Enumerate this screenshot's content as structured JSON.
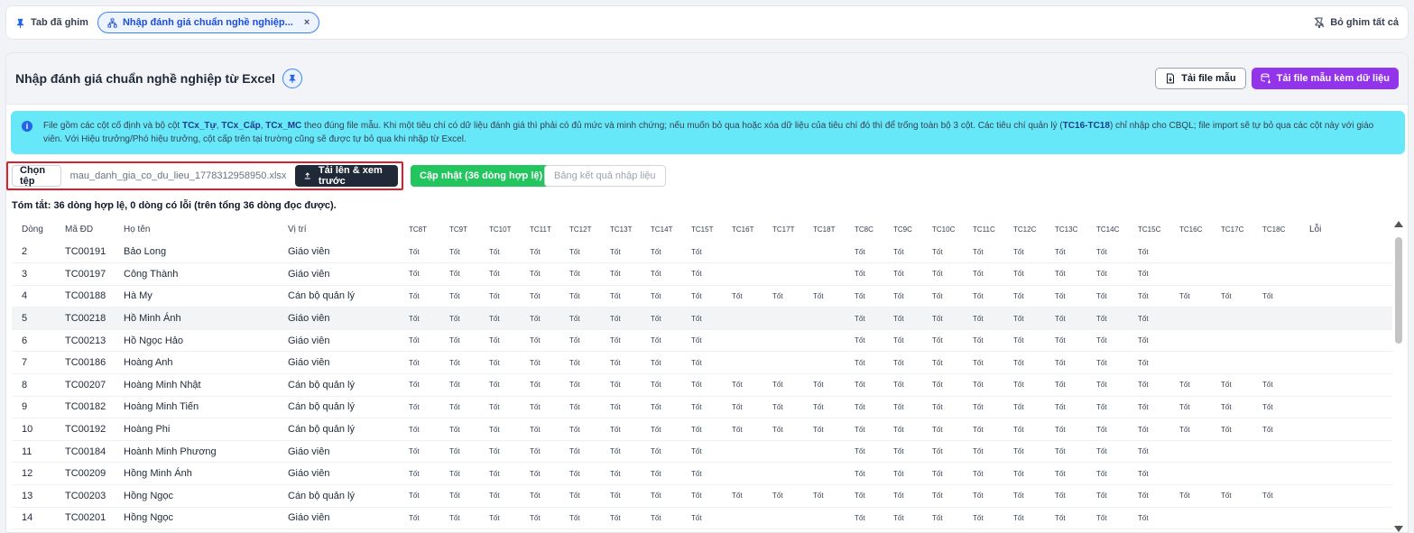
{
  "pinbar": {
    "label": "Tab đã ghim",
    "tab_label": "Nhập đánh giá chuẩn nghề nghiệp...",
    "tab_close": "×",
    "unpin_all": "Bỏ ghim tất cả"
  },
  "header": {
    "title": "Nhập đánh giá chuẩn nghề nghiệp từ Excel",
    "download_template": "Tải file mẫu",
    "download_template_with_data": "Tải file mẫu kèm dữ liệu"
  },
  "info": {
    "part1": "File gồm các cột cố định và bộ cột ",
    "tc_tu": "TCx_Tự",
    "sep1": ", ",
    "tc_cap": "TCx_Cấp",
    "sep2": ", ",
    "tc_mc": "TCx_MC",
    "part2": " theo đúng file mẫu. Khi một tiêu chí có dữ liệu đánh giá thì phải có đủ mức và minh chứng; nếu muốn bỏ qua hoặc xóa dữ liệu của tiêu chí đó thì để trống toàn bộ 3 cột. Các tiêu chí quản lý (",
    "tc_range": "TC16-TC18",
    "part3": ") chỉ nhập cho CBQL; file import sẽ tự bỏ qua các cột này với giáo viên. Với Hiệu trưởng/Phó hiệu trưởng, cột cấp trên tại trường cũng sẽ được tự bỏ qua khi nhập từ Excel."
  },
  "file_row": {
    "choose_label": "Chọn tệp",
    "file_name": "mau_danh_gia_co_du_lieu_1778312958950.xlsx",
    "upload_label": "Tải lên & xem trước",
    "update_label": "Cập nhật (36 dòng hợp lệ)",
    "result_label": "Bảng kết quả nhập liệu"
  },
  "summary": "Tóm tắt: 36 dòng hợp lệ, 0 dòng có lỗi (trên tổng 36 dòng đọc được).",
  "table": {
    "headers": {
      "row": "Dòng",
      "code": "Mã ĐD",
      "name": "Họ tên",
      "position": "Vị trí",
      "tc": [
        "TC8T",
        "TC9T",
        "TC10T",
        "TC11T",
        "TC12T",
        "TC13T",
        "TC14T",
        "TC15T",
        "TC16T",
        "TC17T",
        "TC18T",
        "TC8C",
        "TC9C",
        "TC10C",
        "TC11C",
        "TC12C",
        "TC13C",
        "TC14C",
        "TC15C",
        "TC16C",
        "TC17C",
        "TC18C"
      ],
      "error": "Lỗi"
    },
    "rows": [
      {
        "row": "2",
        "code": "TC00191",
        "name": "Bảo Long",
        "position": "Giáo viên",
        "manager": false
      },
      {
        "row": "3",
        "code": "TC00197",
        "name": "Công Thành",
        "position": "Giáo viên",
        "manager": false
      },
      {
        "row": "4",
        "code": "TC00188",
        "name": "Hà My",
        "position": "Cán bộ quản lý",
        "manager": true
      },
      {
        "row": "5",
        "code": "TC00218",
        "name": "Hồ Minh Ánh",
        "position": "Giáo viên",
        "manager": false
      },
      {
        "row": "6",
        "code": "TC00213",
        "name": "Hồ Ngọc Hảo",
        "position": "Giáo viên",
        "manager": false
      },
      {
        "row": "7",
        "code": "TC00186",
        "name": "Hoàng Anh",
        "position": "Giáo viên",
        "manager": false
      },
      {
        "row": "8",
        "code": "TC00207",
        "name": "Hoàng Minh Nhật",
        "position": "Cán bộ quản lý",
        "manager": true
      },
      {
        "row": "9",
        "code": "TC00182",
        "name": "Hoàng Minh Tiến",
        "position": "Cán bộ quản lý",
        "manager": true
      },
      {
        "row": "10",
        "code": "TC00192",
        "name": "Hoàng Phi",
        "position": "Cán bộ quản lý",
        "manager": true
      },
      {
        "row": "11",
        "code": "TC00184",
        "name": "Hoành Minh Phương",
        "position": "Giáo viên",
        "manager": false
      },
      {
        "row": "12",
        "code": "TC00209",
        "name": "Hồng Minh Ánh",
        "position": "Giáo viên",
        "manager": false
      },
      {
        "row": "13",
        "code": "TC00203",
        "name": "Hồng Ngọc",
        "position": "Cán bộ quản lý",
        "manager": true
      },
      {
        "row": "14",
        "code": "TC00201",
        "name": "Hồng Ngọc",
        "position": "Giáo viên",
        "manager": false
      }
    ],
    "grade": "Tốt",
    "highlight_row_index": 3
  }
}
